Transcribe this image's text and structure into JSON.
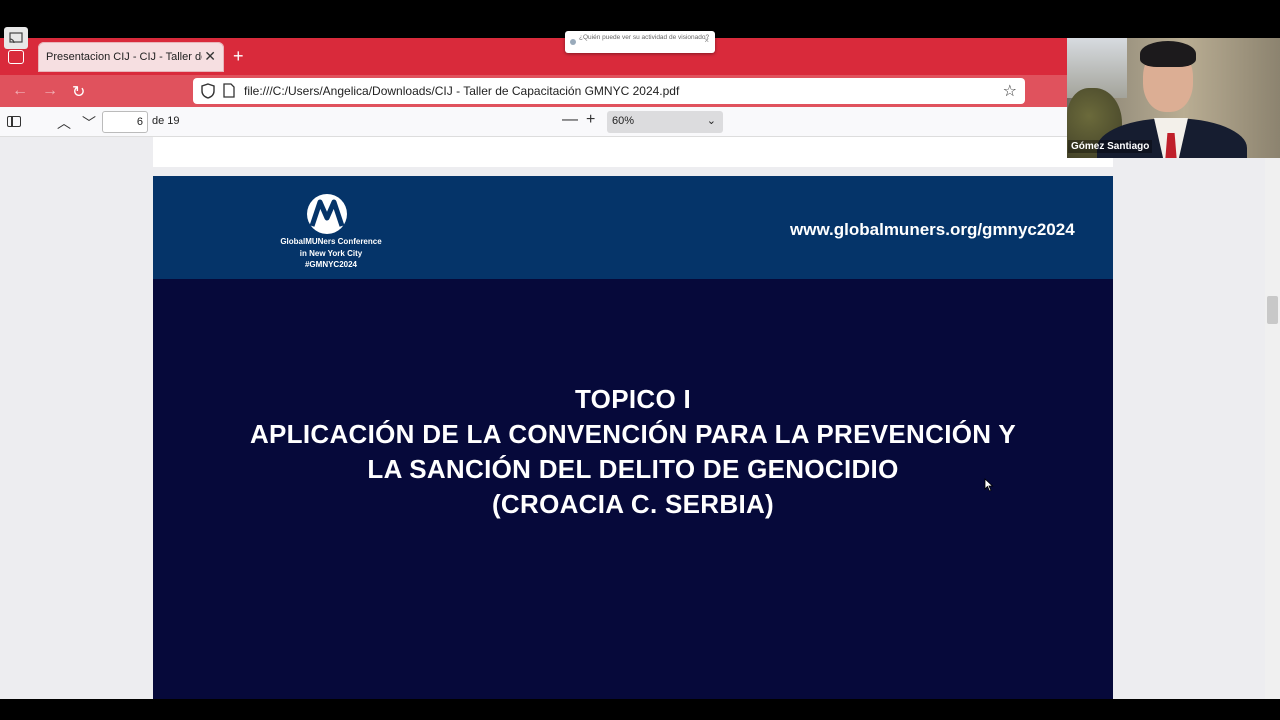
{
  "browser": {
    "tab_title": "Presentacion CIJ - CIJ - Taller de Capacitación GMNYC 2024.pdf",
    "new_tab_label": "+",
    "tab_close": "✕",
    "url": "file:///C:/Users/Angelica/Downloads/CIJ - Taller de Capacitación GMNYC 2024.pdf",
    "accent_color": "#d92a3b"
  },
  "tooltip": {
    "text": "¿Quién puede ver su actividad de visionado?",
    "close": "×"
  },
  "pdf_toolbar": {
    "page_current": "6",
    "page_total": "de 19",
    "zoom": "60%",
    "zoom_out": "—",
    "zoom_in": "+"
  },
  "slide": {
    "logo_text": [
      "GlobalMUNers Conference",
      "in New York City",
      "#GMNYC2024"
    ],
    "website": "www.globalmuners.org/gmnyc2024",
    "title_lines": [
      "TOPICO I",
      "APLICACIÓN DE LA CONVENCIÓN PARA LA PREVENCIÓN Y",
      "LA SANCIÓN DEL DELITO DE GENOCIDIO",
      "(CROACIA C. SERBIA)"
    ],
    "header_color": "#053469",
    "background_color": "#06093a"
  },
  "webcam": {
    "participant_name": "Gómez Santiago"
  }
}
